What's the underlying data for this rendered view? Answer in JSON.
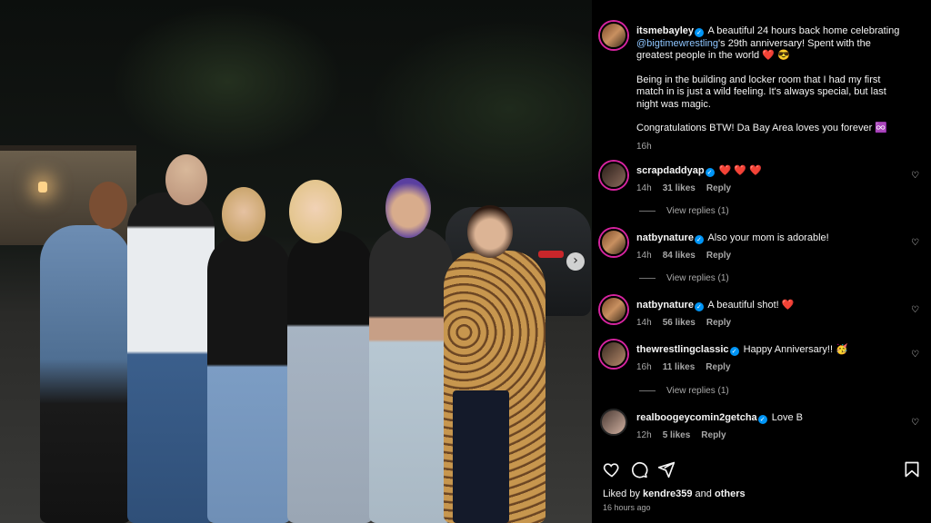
{
  "post": {
    "author": "itsmebayley",
    "caption_part1": "A beautiful 24 hours back home celebrating",
    "mention": "@bigtimewrestling",
    "caption_part2": "'s 29th anniversary! Spent with the greatest people in the world",
    "caption_emoji": "❤️ 😎 ",
    "caption_para2": "Being in the building and locker room that I had my first match in is just a wild feeling. It's always special, but last night was magic.",
    "caption_para3": "Congratulations BTW! Da Bay Area loves you forever ♾️",
    "caption_time": "16h"
  },
  "comments": [
    {
      "user": "scrapdaddyap",
      "verified": true,
      "text": "❤️ ❤️ ❤️",
      "time": "14h",
      "likes": "31 likes",
      "reply": "Reply",
      "view_replies": "View replies (1)"
    },
    {
      "user": "natbynature",
      "verified": true,
      "text": "Also your mom is adorable!",
      "time": "14h",
      "likes": "84 likes",
      "reply": "Reply",
      "view_replies": "View replies (1)"
    },
    {
      "user": "natbynature",
      "verified": true,
      "text": "A beautiful shot! ❤️",
      "time": "14h",
      "likes": "56 likes",
      "reply": "Reply"
    },
    {
      "user": "thewrestlingclassic",
      "verified": true,
      "text": "Happy Anniversary!! 🥳",
      "time": "16h",
      "likes": "11 likes",
      "reply": "Reply",
      "view_replies": "View replies (1)"
    },
    {
      "user": "realboogeycomin2getcha",
      "verified": true,
      "text": "Love B",
      "time": "12h",
      "likes": "5 likes",
      "reply": "Reply"
    }
  ],
  "footer": {
    "liked_by_prefix": "Liked by",
    "liked_by_user": "kendre359",
    "liked_by_and": "and",
    "liked_by_others": "others",
    "time_ago": "16 hours ago"
  },
  "icons": {
    "verified": "✓",
    "carousel_next": "›",
    "comment_like": "♡"
  },
  "colors": {
    "verified_blue": "#0095f6",
    "heart_red": "#ff3040",
    "mention_blue": "#8fc6ff"
  }
}
